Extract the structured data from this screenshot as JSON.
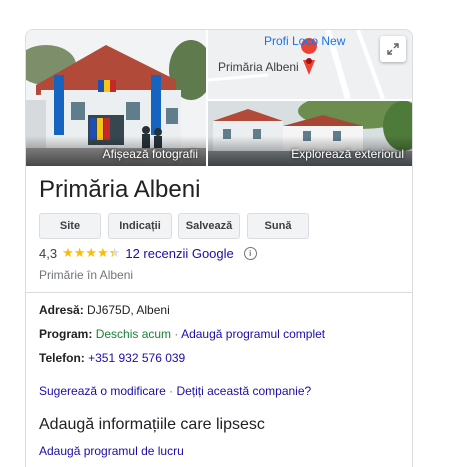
{
  "photos": {
    "main_label": "Afișează fotografii",
    "exterior_label": "Explorează exteriorul",
    "map": {
      "business_label": "Profi Loco New",
      "place_label": "Primăria Albeni",
      "expand_icon": "expand-icon"
    }
  },
  "place": {
    "title": "Primăria Albeni",
    "category": "Primărie în Albeni"
  },
  "actions": {
    "website": "Site",
    "directions": "Indicații",
    "save": "Salvează",
    "call": "Sună"
  },
  "rating": {
    "value": "4,3",
    "stars": 4.3,
    "reviews": "12 recenzii Google"
  },
  "details": {
    "address_label": "Adresă:",
    "address_value": "DJ675D, Albeni",
    "hours_label": "Program:",
    "hours_status": "Deschis acum",
    "hours_separator": "·",
    "hours_link": "Adaugă programul complet",
    "phone_label": "Telefon:",
    "phone_value": "+351 932 576 039"
  },
  "footer_links": {
    "suggest": "Sugerează o modificare",
    "separator": "·",
    "own": "Dețiți această companie?"
  },
  "missing_info": {
    "title": "Adaugă informațiile care lipsesc",
    "add_hours": "Adaugă programul de lucru"
  },
  "colors": {
    "link": "#1a0dab",
    "open": "#188038",
    "star": "#fbbc04",
    "pin": "#ea4335",
    "map_text": "#1a73e8"
  }
}
